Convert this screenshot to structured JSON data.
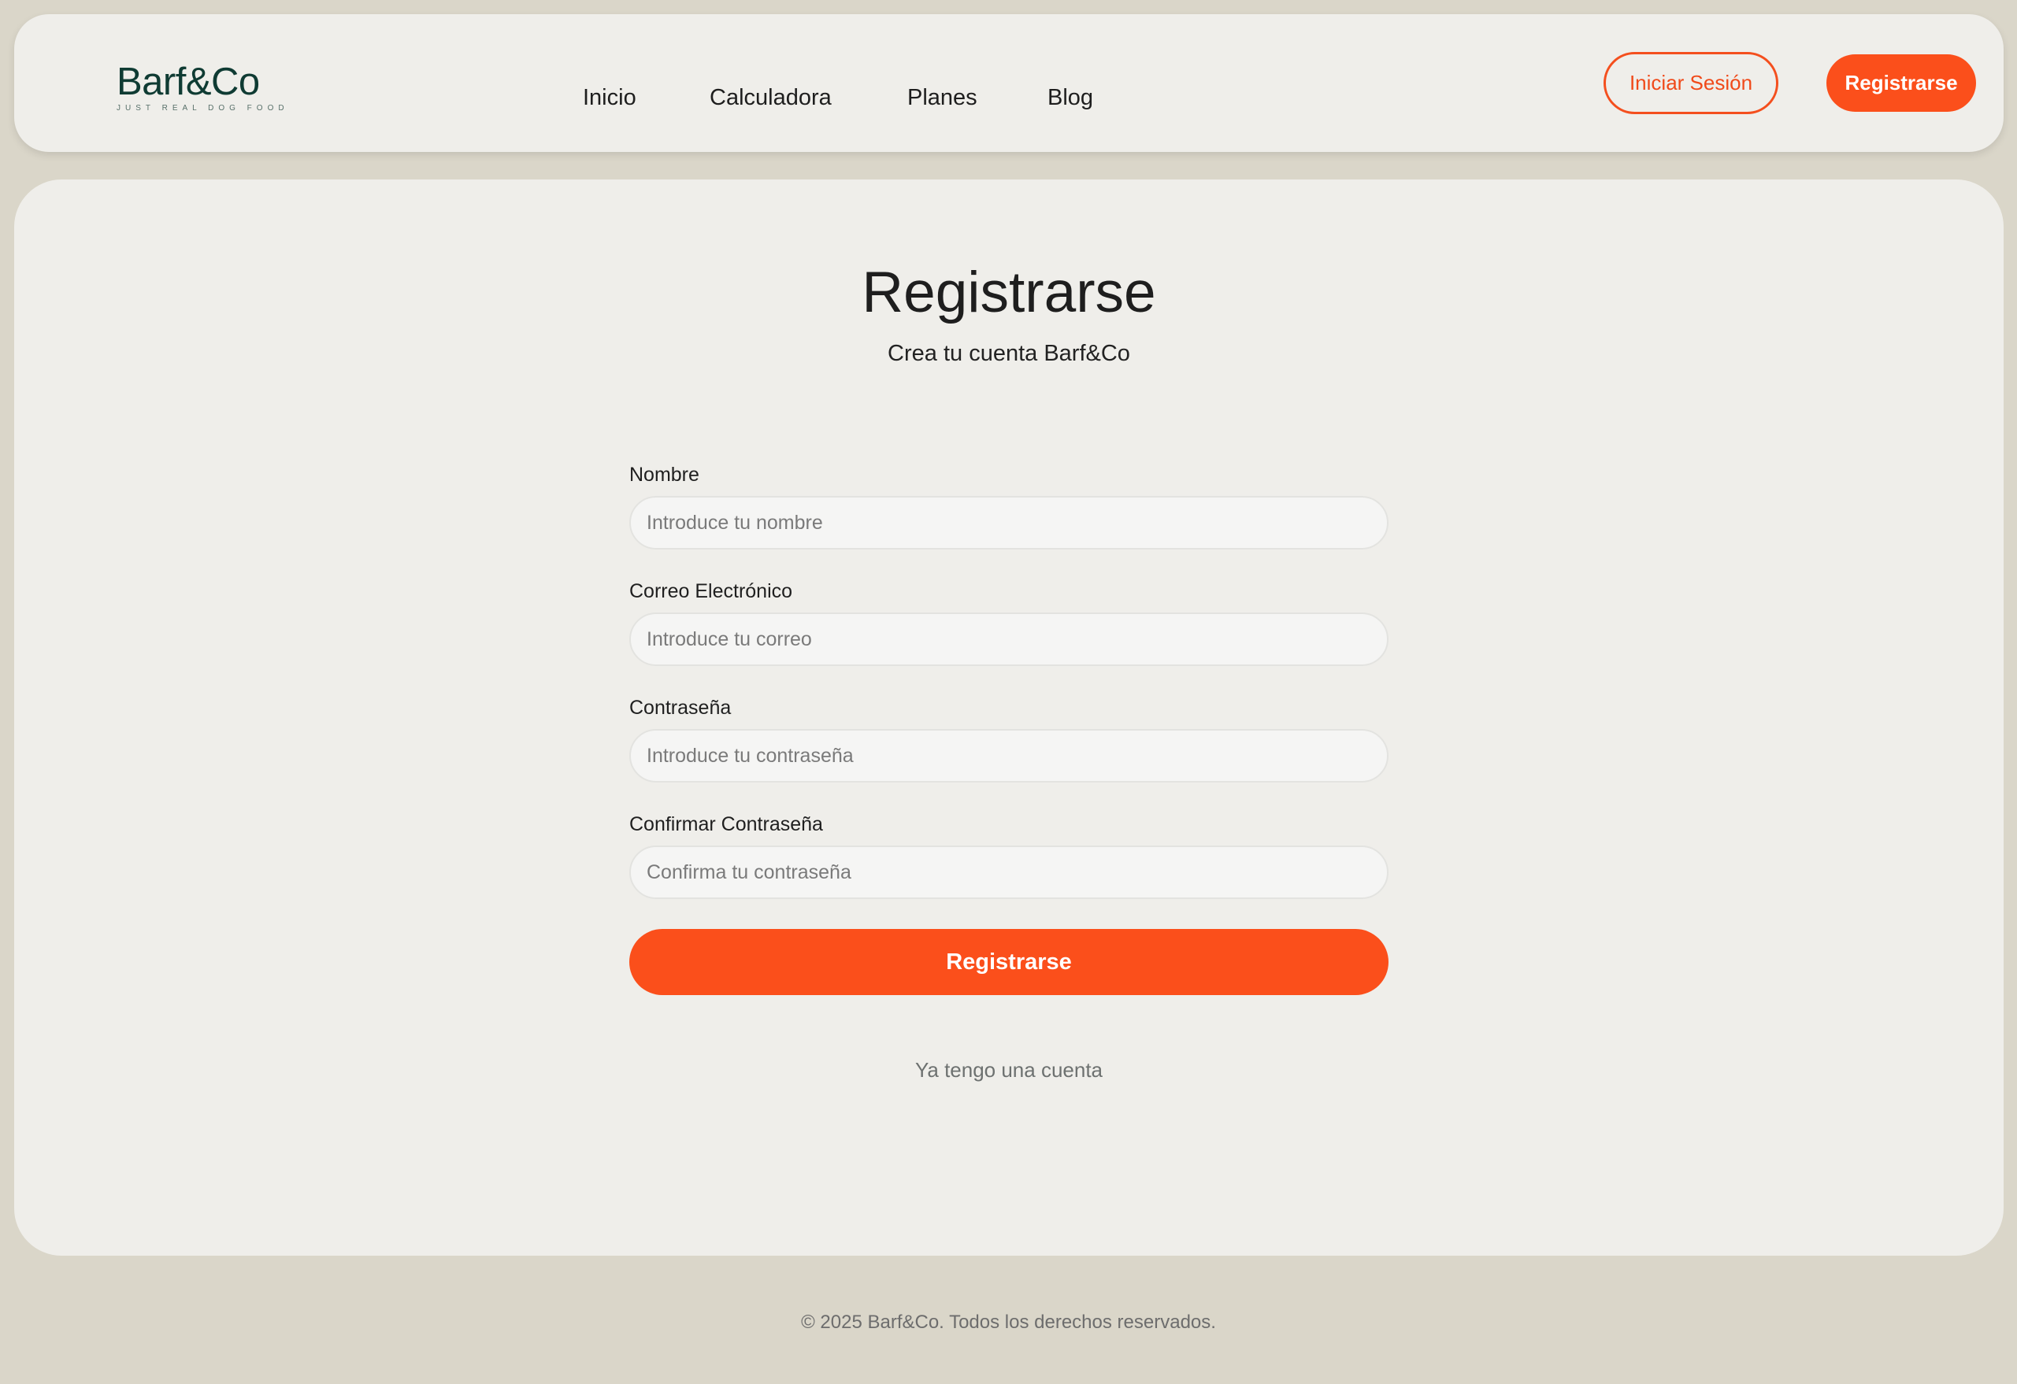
{
  "brand": {
    "name": "Barf&Co",
    "tagline": "JUST REAL DOG FOOD"
  },
  "nav": {
    "items": [
      {
        "label": "Inicio"
      },
      {
        "label": "Calculadora"
      },
      {
        "label": "Planes"
      },
      {
        "label": "Blog"
      }
    ],
    "login_label": "Iniciar Sesión",
    "register_label": "Registrarse"
  },
  "colors": {
    "accent": "#fb4f1b",
    "brand": "#0f3b33",
    "page_bg": "#dad6c9",
    "card_bg": "#efeeea"
  },
  "form": {
    "title": "Registrarse",
    "subtitle": "Crea tu cuenta Barf&Co",
    "fields": [
      {
        "label": "Nombre",
        "placeholder": "Introduce tu nombre",
        "value": ""
      },
      {
        "label": "Correo Electrónico",
        "placeholder": "Introduce tu correo",
        "value": ""
      },
      {
        "label": "Contraseña",
        "placeholder": "Introduce tu contraseña",
        "value": ""
      },
      {
        "label": "Confirmar Contraseña",
        "placeholder": "Confirma tu contraseña",
        "value": ""
      }
    ],
    "submit_label": "Registrarse",
    "login_link": "Ya tengo una cuenta"
  },
  "footer": {
    "copyright": "© 2025 Barf&Co. Todos los derechos reservados."
  }
}
